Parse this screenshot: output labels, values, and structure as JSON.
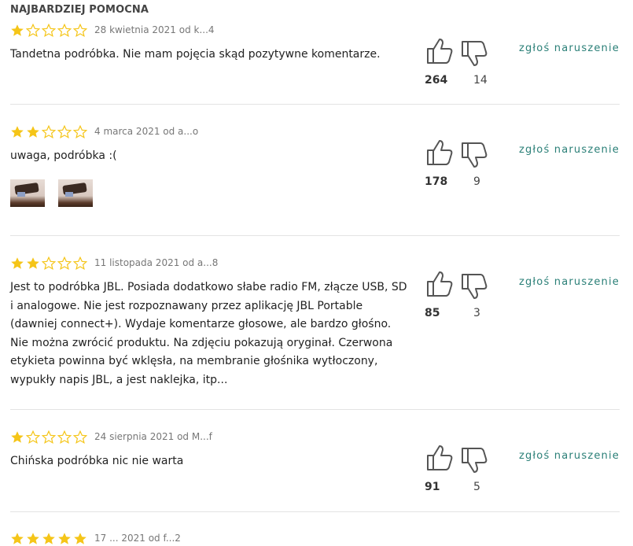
{
  "section_title": "NAJBARDZIEJ POMOCNA",
  "colors": {
    "star_filled": "#f5c518",
    "star_empty": "#f5c518",
    "report_link": "#2a7f77"
  },
  "report_label": "zgłoś naruszenie",
  "reviews": [
    {
      "rating": 1,
      "meta": "28 kwietnia 2021 od k...4",
      "text": "Tandetna podróbka. Nie mam pojęcia skąd pozytywne komentarze.",
      "helpful": "264",
      "unhelpful": "14"
    },
    {
      "rating": 2,
      "meta": "4 marca 2021 od a...o",
      "text": "uwaga, podróbka :(",
      "helpful": "178",
      "unhelpful": "9",
      "photos": 2
    },
    {
      "rating": 2,
      "meta": "11 listopada 2021 od a...8",
      "text": "Jest to podróbka JBL. Posiada dodatkowo słabe radio FM, złącze USB, SD i analogowe. Nie jest rozpoznawany przez aplikację JBL Portable (dawniej connect+). Wydaje komentarze głosowe, ale bardzo głośno. Nie można zwrócić produktu. Na zdjęciu pokazują oryginał. Czerwona etykieta powinna być wklęsła, na membranie głośnika wytłoczony, wypukły napis JBL, a jest naklejka, itp...",
      "helpful": "85",
      "unhelpful": "3"
    },
    {
      "rating": 1,
      "meta": "24 sierpnia 2021 od M...f",
      "text": "Chińska podróbka nic nie warta",
      "helpful": "91",
      "unhelpful": "5"
    },
    {
      "rating": 5,
      "meta": "17 ... 2021 od f...2",
      "text": "",
      "helpful": "",
      "unhelpful": ""
    }
  ]
}
